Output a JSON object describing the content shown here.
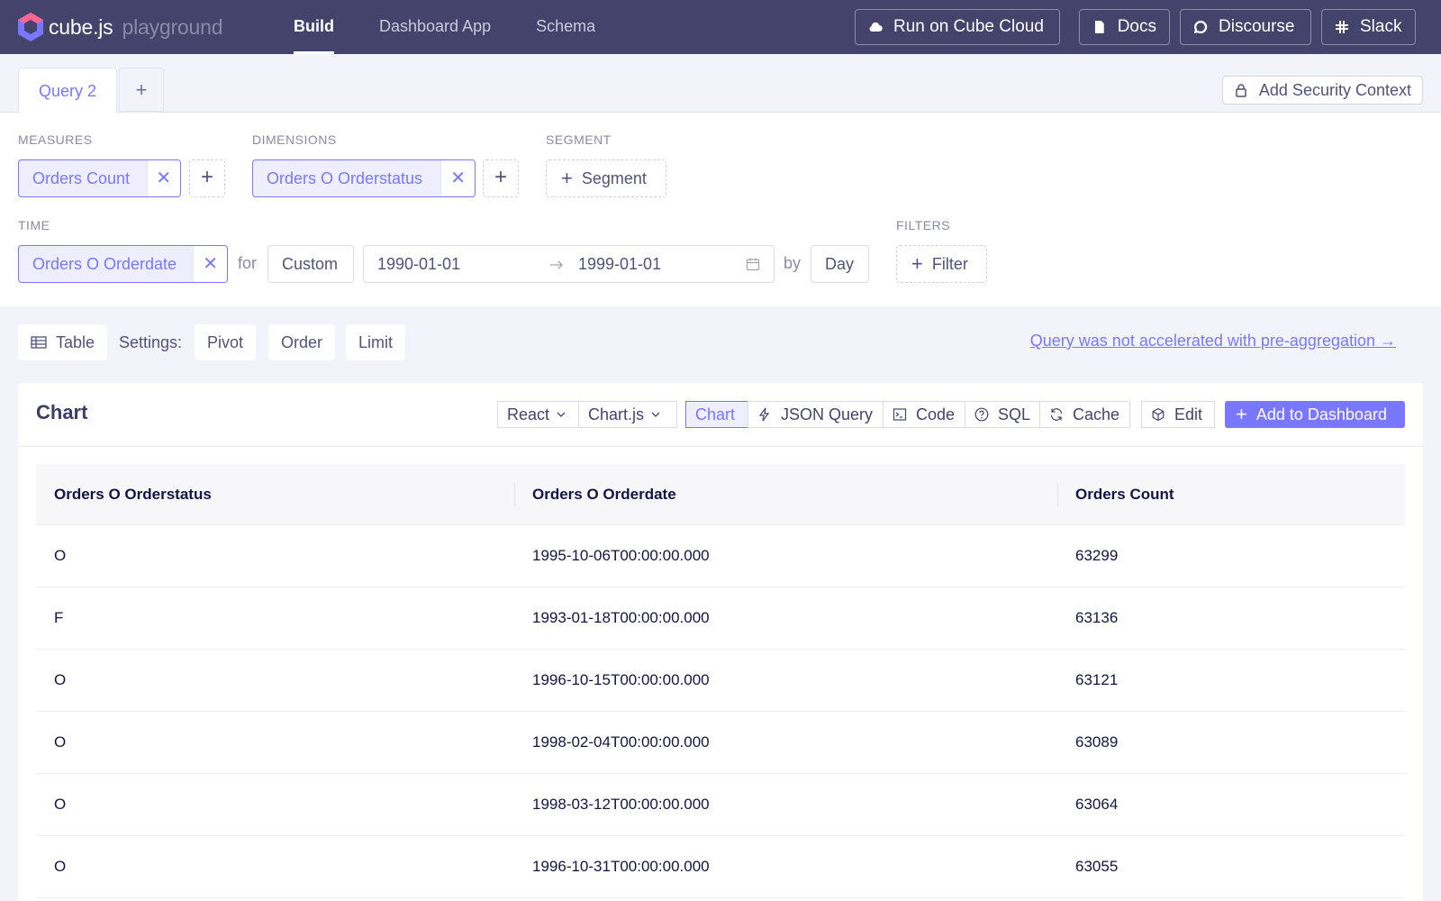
{
  "app": {
    "brand": "cube.js",
    "brand_sub": "playground",
    "nav": [
      {
        "label": "Build",
        "active": true
      },
      {
        "label": "Dashboard App",
        "active": false
      },
      {
        "label": "Schema",
        "active": false
      }
    ],
    "buttons": {
      "cloud": "Run on Cube Cloud",
      "docs": "Docs",
      "discourse": "Discourse",
      "slack": "Slack"
    }
  },
  "query_tabs": {
    "active_tab": "Query 2",
    "add_label": "+",
    "security_context": "Add Security Context"
  },
  "builder": {
    "measures_label": "MEASURES",
    "measures": [
      "Orders Count"
    ],
    "dimensions_label": "DIMENSIONS",
    "dimensions": [
      "Orders O Orderstatus"
    ],
    "segment_label": "SEGMENT",
    "segment_button": "Segment",
    "time_label": "TIME",
    "time_dimension": "Orders O Orderdate",
    "for_text": "for",
    "date_range_type": "Custom",
    "date_from": "1990-01-01",
    "date_to": "1999-01-01",
    "by_text": "by",
    "granularity": "Day",
    "filters_label": "FILTERS",
    "filter_button": "Filter"
  },
  "settings": {
    "view": "Table",
    "settings_label": "Settings:",
    "pivot": "Pivot",
    "order": "Order",
    "limit": "Limit",
    "accel_link": "Query was not accelerated with pre-aggregation →"
  },
  "card": {
    "title": "Chart",
    "framework": "React",
    "library": "Chart.js",
    "tabs": {
      "chart": "Chart",
      "json": "JSON Query",
      "code": "Code",
      "sql": "SQL",
      "cache": "Cache"
    },
    "edit": "Edit",
    "add_dashboard": "Add to Dashboard"
  },
  "table": {
    "headers": [
      "Orders O Orderstatus",
      "Orders O Orderdate",
      "Orders Count"
    ],
    "rows": [
      [
        "O",
        "1995-10-06T00:00:00.000",
        "63299"
      ],
      [
        "F",
        "1993-01-18T00:00:00.000",
        "63136"
      ],
      [
        "O",
        "1996-10-15T00:00:00.000",
        "63121"
      ],
      [
        "O",
        "1998-02-04T00:00:00.000",
        "63089"
      ],
      [
        "O",
        "1998-03-12T00:00:00.000",
        "63064"
      ],
      [
        "O",
        "1996-10-31T00:00:00.000",
        "63055"
      ]
    ]
  },
  "colors": {
    "nav_bg": "#43436b",
    "accent": "#7a77ff",
    "page_bg": "#f3f3fb"
  }
}
